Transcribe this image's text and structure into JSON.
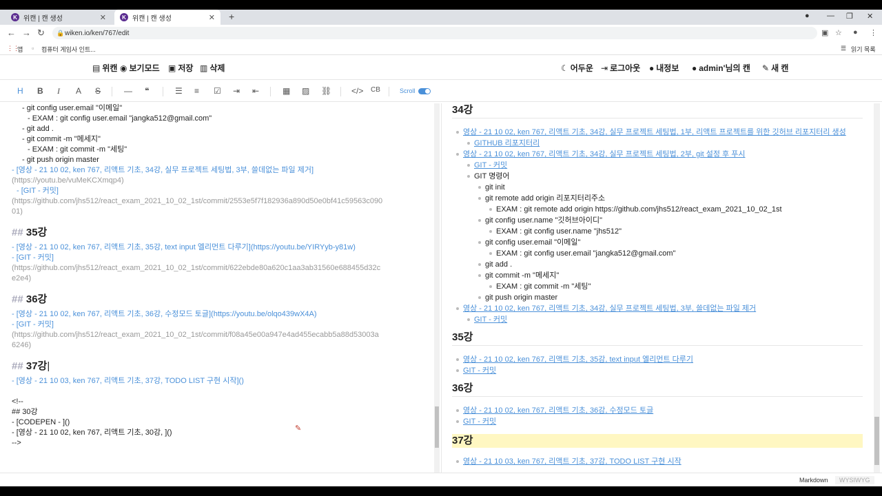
{
  "browser": {
    "tabs": [
      {
        "title": "위캔 | 캔 생성",
        "favicon": "K"
      },
      {
        "title": "위캔 | 캔 생성",
        "favicon": "K"
      }
    ],
    "url": "wiken.io/ken/767/edit",
    "bookmarks": [
      "앱",
      "컴퓨터 게임사 인트...",
      "읽기 목록"
    ]
  },
  "appnav": {
    "left": [
      "위캔",
      "보기모드",
      "저장",
      "삭제"
    ],
    "right": [
      "어두운",
      "로그아웃",
      "내정보",
      "admin'님의 캔",
      "새 캔"
    ]
  },
  "toolbar": {
    "scroll_label": "Scroll",
    "cb_label": "CB"
  },
  "editor": {
    "lines": {
      "l1": "- git config user.email \"이메일\"",
      "l2": "- EXAM : git config user.email \"jangka512@gmail.com\"",
      "l3": "- git add .",
      "l4": "- git commit -m \"메세지\"",
      "l5": "- EXAM : git commit -m \"세팅\"",
      "l6": "- git push origin master",
      "l7": "- [영상 - 21 10 02, ken 767, 리액트 기초, 34강, 실무 프로젝트 세팅법, 3부, 쓸데없는 파일 제거]",
      "l8": "(https://youtu.be/vuMeKCXmqp4)",
      "l9": "- [GIT - 커밋]",
      "l10": "(https://github.com/jhs512/react_exam_2021_10_02_1st/commit/2553e5f7f182936a890d50e0bf41c59563c090",
      "l11": "01)",
      "h35": "35강",
      "l12": "- [영상 - 21 10 02, ken 767, 리액트 기초, 35강, text input 엘리먼트 다루기](https://youtu.be/YIRYyb-y81w)",
      "l13": "- [GIT - 커밋]",
      "l14": "(https://github.com/jhs512/react_exam_2021_10_02_1st/commit/622ebde80a620c1aa3ab31560e688455d32c",
      "l15": "e2e4)",
      "h36": "36강",
      "l16": "- [영상 - 21 10 02, ken 767, 리액트 기초, 36강, 수정모드 토글](https://youtu.be/olqo439wX4A)",
      "l17": "- [GIT - 커밋]",
      "l18": "(https://github.com/jhs512/react_exam_2021_10_02_1st/commit/f08a45e00a947e4ad455ecabb5a88d53003a",
      "l19": "6246)",
      "h37": "37강",
      "l20": "- [영상 - 21 10 03, ken 767, 리액트 기초, 37강, TODO LIST 구현 시작]()",
      "l21": "<!--",
      "l22": "## 30강",
      "l23": "- [CODEPEN - ]()",
      "l24": "- [영상 - 21 10 02, ken 767, 리액트 기초, 30강, ]()",
      "l25": "-->",
      "hash": "##"
    }
  },
  "preview": {
    "h34": "34강",
    "p1": "영상 - 21 10 02, ken 767, 리액트 기초, 34강, 실무 프로젝트 세팅법, 1부, 리액트 프로젝트를 위한 깃허브 리포지터리 생성",
    "p2": "GITHUB 리포지터리",
    "p3": "영상 - 21 10 02, ken 767, 리액트 기초, 34강, 실무 프로젝트 세팅법, 2부, git 설정 후 푸시",
    "p4": "GIT - 커밋",
    "p5": "GIT 명령어",
    "p6": "git init",
    "p7": "git remote add origin 리포지터리주소",
    "p8": "EXAM : git remote add origin https://github.com/jhs512/react_exam_2021_10_02_1st",
    "p9": "git config user.name \"깃허브아이디\"",
    "p10": "EXAM : git config user.name \"jhs512\"",
    "p11": "git config user.email \"이메일\"",
    "p12": "EXAM : git config user.email \"jangka512@gmail.com\"",
    "p13": "git add .",
    "p14": "git commit -m \"메세지\"",
    "p15": "EXAM : git commit -m \"세팅\"",
    "p16": "git push origin master",
    "p17": "영상 - 21 10 02, ken 767, 리액트 기초, 34강, 실무 프로젝트 세팅법, 3부, 쓸데없는 파일 제거",
    "p18": "GIT - 커밋",
    "h35": "35강",
    "p19": "영상 - 21 10 02, ken 767, 리액트 기초, 35강, text input 엘리먼트 다루기",
    "p20": "GIT - 커밋",
    "h36": "36강",
    "p21": "영상 - 21 10 02, ken 767, 리액트 기초, 36강, 수정모드 토글",
    "p22": "GIT - 커밋",
    "h37": "37강",
    "p23": "영상 - 21 10 03, ken 767, 리액트 기초, 37강, TODO LIST 구현 시작"
  },
  "statusbar": {
    "markdown": "Markdown",
    "wysiwyg": "WYSIWYG"
  },
  "colors": {
    "accent": "#4a90d9",
    "highlight": "#fff7c2",
    "favicon": "#5b2d90"
  }
}
